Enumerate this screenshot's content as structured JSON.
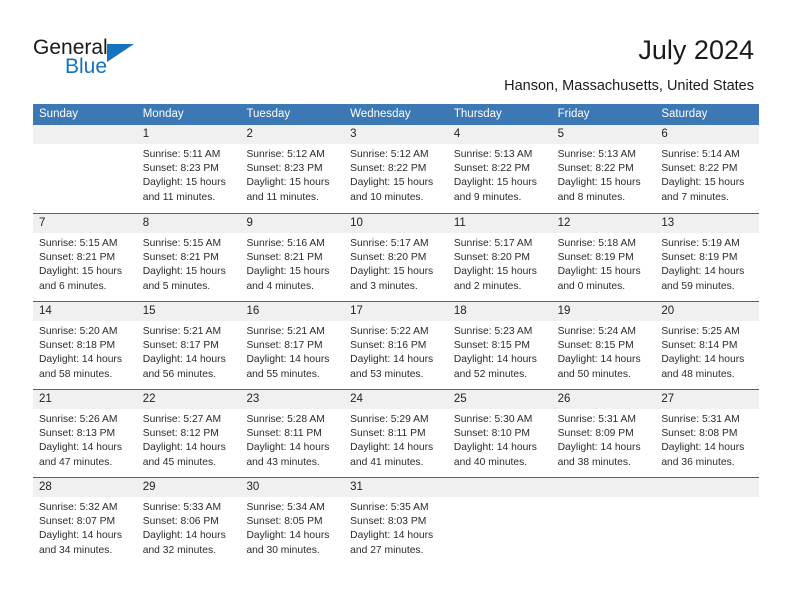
{
  "logo": {
    "word_top": "General",
    "word_bottom": "Blue",
    "accent_color": "#1473bc"
  },
  "header": {
    "title": "July 2024",
    "location": "Hanson, Massachusetts, United States"
  },
  "theme": {
    "header_bg": "#3c78b4",
    "header_text": "#ffffff",
    "daynum_bg": "#f0f0f0",
    "row_divider": "#2e6da4"
  },
  "weekdays": [
    "Sunday",
    "Monday",
    "Tuesday",
    "Wednesday",
    "Thursday",
    "Friday",
    "Saturday"
  ],
  "weeks": [
    [
      {
        "day": "",
        "sunrise": "",
        "sunset": "",
        "daylight1": "",
        "daylight2": ""
      },
      {
        "day": "1",
        "sunrise": "Sunrise: 5:11 AM",
        "sunset": "Sunset: 8:23 PM",
        "daylight1": "Daylight: 15 hours",
        "daylight2": "and 11 minutes."
      },
      {
        "day": "2",
        "sunrise": "Sunrise: 5:12 AM",
        "sunset": "Sunset: 8:23 PM",
        "daylight1": "Daylight: 15 hours",
        "daylight2": "and 11 minutes."
      },
      {
        "day": "3",
        "sunrise": "Sunrise: 5:12 AM",
        "sunset": "Sunset: 8:22 PM",
        "daylight1": "Daylight: 15 hours",
        "daylight2": "and 10 minutes."
      },
      {
        "day": "4",
        "sunrise": "Sunrise: 5:13 AM",
        "sunset": "Sunset: 8:22 PM",
        "daylight1": "Daylight: 15 hours",
        "daylight2": "and 9 minutes."
      },
      {
        "day": "5",
        "sunrise": "Sunrise: 5:13 AM",
        "sunset": "Sunset: 8:22 PM",
        "daylight1": "Daylight: 15 hours",
        "daylight2": "and 8 minutes."
      },
      {
        "day": "6",
        "sunrise": "Sunrise: 5:14 AM",
        "sunset": "Sunset: 8:22 PM",
        "daylight1": "Daylight: 15 hours",
        "daylight2": "and 7 minutes."
      }
    ],
    [
      {
        "day": "7",
        "sunrise": "Sunrise: 5:15 AM",
        "sunset": "Sunset: 8:21 PM",
        "daylight1": "Daylight: 15 hours",
        "daylight2": "and 6 minutes."
      },
      {
        "day": "8",
        "sunrise": "Sunrise: 5:15 AM",
        "sunset": "Sunset: 8:21 PM",
        "daylight1": "Daylight: 15 hours",
        "daylight2": "and 5 minutes."
      },
      {
        "day": "9",
        "sunrise": "Sunrise: 5:16 AM",
        "sunset": "Sunset: 8:21 PM",
        "daylight1": "Daylight: 15 hours",
        "daylight2": "and 4 minutes."
      },
      {
        "day": "10",
        "sunrise": "Sunrise: 5:17 AM",
        "sunset": "Sunset: 8:20 PM",
        "daylight1": "Daylight: 15 hours",
        "daylight2": "and 3 minutes."
      },
      {
        "day": "11",
        "sunrise": "Sunrise: 5:17 AM",
        "sunset": "Sunset: 8:20 PM",
        "daylight1": "Daylight: 15 hours",
        "daylight2": "and 2 minutes."
      },
      {
        "day": "12",
        "sunrise": "Sunrise: 5:18 AM",
        "sunset": "Sunset: 8:19 PM",
        "daylight1": "Daylight: 15 hours",
        "daylight2": "and 0 minutes."
      },
      {
        "day": "13",
        "sunrise": "Sunrise: 5:19 AM",
        "sunset": "Sunset: 8:19 PM",
        "daylight1": "Daylight: 14 hours",
        "daylight2": "and 59 minutes."
      }
    ],
    [
      {
        "day": "14",
        "sunrise": "Sunrise: 5:20 AM",
        "sunset": "Sunset: 8:18 PM",
        "daylight1": "Daylight: 14 hours",
        "daylight2": "and 58 minutes."
      },
      {
        "day": "15",
        "sunrise": "Sunrise: 5:21 AM",
        "sunset": "Sunset: 8:17 PM",
        "daylight1": "Daylight: 14 hours",
        "daylight2": "and 56 minutes."
      },
      {
        "day": "16",
        "sunrise": "Sunrise: 5:21 AM",
        "sunset": "Sunset: 8:17 PM",
        "daylight1": "Daylight: 14 hours",
        "daylight2": "and 55 minutes."
      },
      {
        "day": "17",
        "sunrise": "Sunrise: 5:22 AM",
        "sunset": "Sunset: 8:16 PM",
        "daylight1": "Daylight: 14 hours",
        "daylight2": "and 53 minutes."
      },
      {
        "day": "18",
        "sunrise": "Sunrise: 5:23 AM",
        "sunset": "Sunset: 8:15 PM",
        "daylight1": "Daylight: 14 hours",
        "daylight2": "and 52 minutes."
      },
      {
        "day": "19",
        "sunrise": "Sunrise: 5:24 AM",
        "sunset": "Sunset: 8:15 PM",
        "daylight1": "Daylight: 14 hours",
        "daylight2": "and 50 minutes."
      },
      {
        "day": "20",
        "sunrise": "Sunrise: 5:25 AM",
        "sunset": "Sunset: 8:14 PM",
        "daylight1": "Daylight: 14 hours",
        "daylight2": "and 48 minutes."
      }
    ],
    [
      {
        "day": "21",
        "sunrise": "Sunrise: 5:26 AM",
        "sunset": "Sunset: 8:13 PM",
        "daylight1": "Daylight: 14 hours",
        "daylight2": "and 47 minutes."
      },
      {
        "day": "22",
        "sunrise": "Sunrise: 5:27 AM",
        "sunset": "Sunset: 8:12 PM",
        "daylight1": "Daylight: 14 hours",
        "daylight2": "and 45 minutes."
      },
      {
        "day": "23",
        "sunrise": "Sunrise: 5:28 AM",
        "sunset": "Sunset: 8:11 PM",
        "daylight1": "Daylight: 14 hours",
        "daylight2": "and 43 minutes."
      },
      {
        "day": "24",
        "sunrise": "Sunrise: 5:29 AM",
        "sunset": "Sunset: 8:11 PM",
        "daylight1": "Daylight: 14 hours",
        "daylight2": "and 41 minutes."
      },
      {
        "day": "25",
        "sunrise": "Sunrise: 5:30 AM",
        "sunset": "Sunset: 8:10 PM",
        "daylight1": "Daylight: 14 hours",
        "daylight2": "and 40 minutes."
      },
      {
        "day": "26",
        "sunrise": "Sunrise: 5:31 AM",
        "sunset": "Sunset: 8:09 PM",
        "daylight1": "Daylight: 14 hours",
        "daylight2": "and 38 minutes."
      },
      {
        "day": "27",
        "sunrise": "Sunrise: 5:31 AM",
        "sunset": "Sunset: 8:08 PM",
        "daylight1": "Daylight: 14 hours",
        "daylight2": "and 36 minutes."
      }
    ],
    [
      {
        "day": "28",
        "sunrise": "Sunrise: 5:32 AM",
        "sunset": "Sunset: 8:07 PM",
        "daylight1": "Daylight: 14 hours",
        "daylight2": "and 34 minutes."
      },
      {
        "day": "29",
        "sunrise": "Sunrise: 5:33 AM",
        "sunset": "Sunset: 8:06 PM",
        "daylight1": "Daylight: 14 hours",
        "daylight2": "and 32 minutes."
      },
      {
        "day": "30",
        "sunrise": "Sunrise: 5:34 AM",
        "sunset": "Sunset: 8:05 PM",
        "daylight1": "Daylight: 14 hours",
        "daylight2": "and 30 minutes."
      },
      {
        "day": "31",
        "sunrise": "Sunrise: 5:35 AM",
        "sunset": "Sunset: 8:03 PM",
        "daylight1": "Daylight: 14 hours",
        "daylight2": "and 27 minutes."
      },
      {
        "day": "",
        "sunrise": "",
        "sunset": "",
        "daylight1": "",
        "daylight2": ""
      },
      {
        "day": "",
        "sunrise": "",
        "sunset": "",
        "daylight1": "",
        "daylight2": ""
      },
      {
        "day": "",
        "sunrise": "",
        "sunset": "",
        "daylight1": "",
        "daylight2": ""
      }
    ]
  ]
}
